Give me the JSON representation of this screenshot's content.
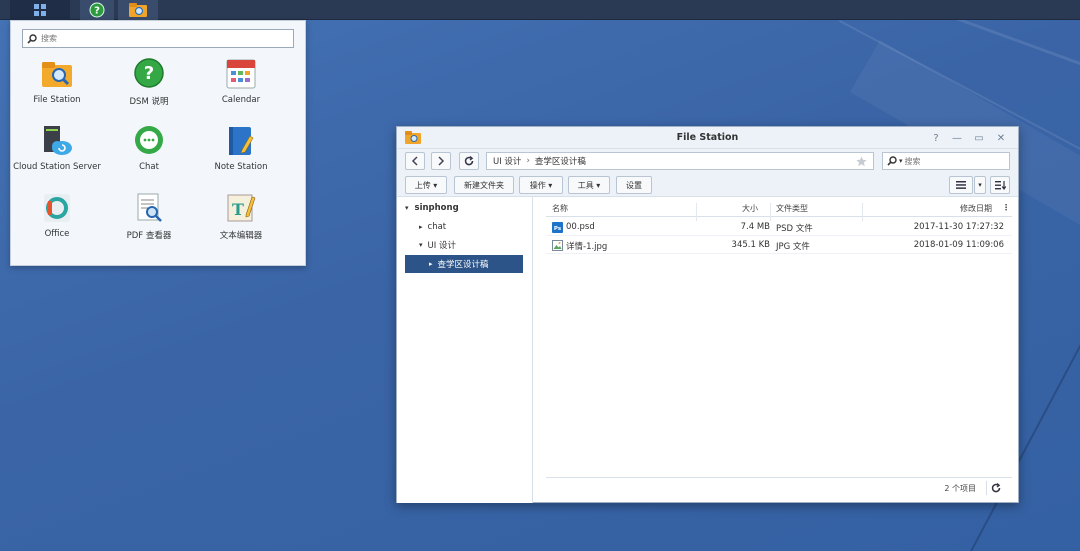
{
  "menu": {
    "search_placeholder": "搜索",
    "apps": [
      {
        "label": "File Station",
        "icon": "file-station-icon"
      },
      {
        "label": "DSM 说明",
        "icon": "help-icon"
      },
      {
        "label": "Calendar",
        "icon": "calendar-icon"
      },
      {
        "label": "Cloud Station Server",
        "icon": "cloud-station-icon"
      },
      {
        "label": "Chat",
        "icon": "chat-icon"
      },
      {
        "label": "Note Station",
        "icon": "note-station-icon"
      },
      {
        "label": "Office",
        "icon": "office-icon"
      },
      {
        "label": "PDF 查看器",
        "icon": "pdf-viewer-icon"
      },
      {
        "label": "文本编辑器",
        "icon": "text-editor-icon"
      }
    ]
  },
  "window": {
    "title": "File Station",
    "controls": {
      "help": "?",
      "minimize": "—",
      "maximize": "▭",
      "close": "✕"
    },
    "path": [
      "UI 设计",
      "查学区设计稿"
    ],
    "search_placeholder": "搜索",
    "toolbar": {
      "upload": "上传 ▾",
      "new_folder": "新建文件夹",
      "action": "操作 ▾",
      "tools": "工具 ▾",
      "settings": "设置"
    },
    "tree": {
      "root": "sinphong",
      "items": [
        "chat",
        "UI 设计",
        "查学区设计稿"
      ]
    },
    "columns": {
      "name": "名称",
      "size": "大小",
      "type": "文件类型",
      "modified": "修改日期"
    },
    "files": [
      {
        "name": "00.psd",
        "size": "7.4 MB",
        "type": "PSD 文件",
        "modified": "2017-11-30 17:27:32",
        "icon": "psd-file-icon"
      },
      {
        "name": "详情-1.jpg",
        "size": "345.1 KB",
        "type": "JPG 文件",
        "modified": "2018-01-09 11:09:06",
        "icon": "jpg-file-icon"
      }
    ],
    "item_count": "2 个项目"
  },
  "colors": {
    "desktop": "#3c67a8",
    "taskbar": "#2a3a55",
    "selection": "#2c5488",
    "accent_green": "#2e9a3e"
  }
}
